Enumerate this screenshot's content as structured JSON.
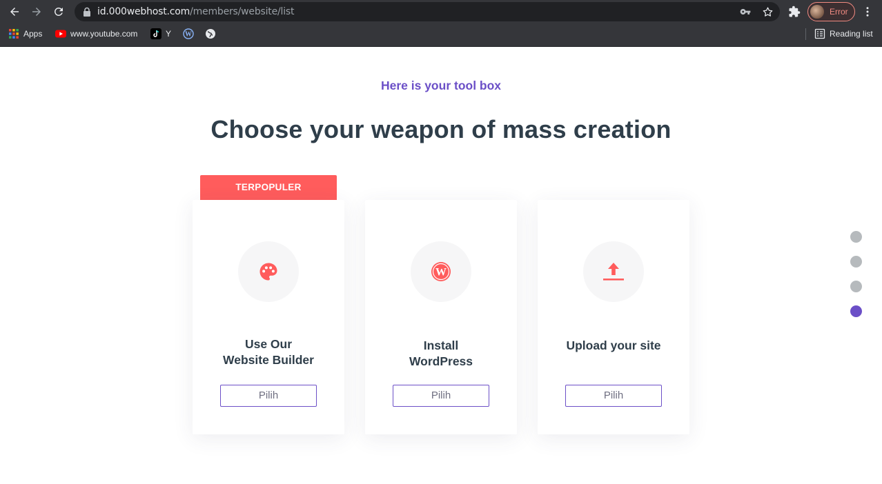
{
  "browser": {
    "url_host": "id.000webhost.com",
    "url_path": "/members/website/list",
    "profile_status": "Error",
    "bookmarks": [
      {
        "label": "Apps",
        "icon": "apps-grid-icon"
      },
      {
        "label": "www.youtube.com",
        "icon": "youtube-icon"
      },
      {
        "label": "Y",
        "icon": "tiktok-icon"
      },
      {
        "label": "",
        "icon": "wordpress-icon"
      },
      {
        "label": "",
        "icon": "globe-icon"
      }
    ],
    "reading_list": "Reading list"
  },
  "page": {
    "eyebrow": "Here is your tool box",
    "headline": "Choose your weapon of mass creation",
    "popular_badge": "TERPOPULER",
    "cards": [
      {
        "title_line1": "Use Our",
        "title_line2": "Website Builder",
        "icon": "palette-icon",
        "button": "Pilih"
      },
      {
        "title_line1": "Install",
        "title_line2": "WordPress",
        "icon": "wordpress-icon",
        "button": "Pilih"
      },
      {
        "title_line1": "Upload your site",
        "title_line2": "",
        "icon": "upload-icon",
        "button": "Pilih"
      }
    ],
    "pager": {
      "count": 4,
      "active_index": 3
    }
  },
  "colors": {
    "accent_purple": "#6b4fc7",
    "accent_red": "#ff5c5c",
    "heading": "#2f3e4a"
  }
}
